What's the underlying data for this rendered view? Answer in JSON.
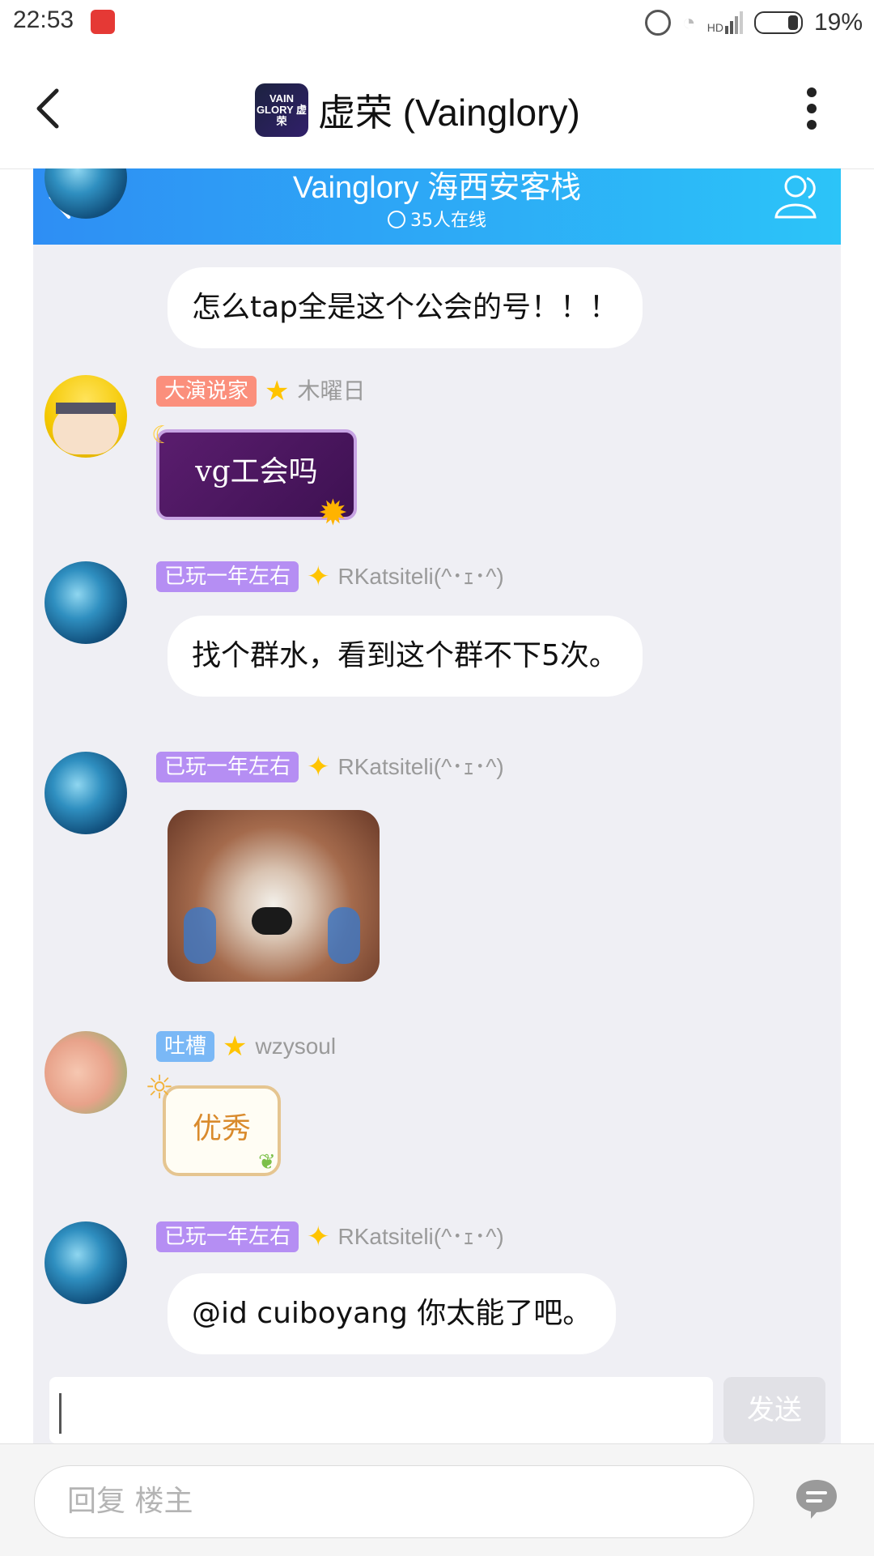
{
  "status_bar": {
    "time": "22:53",
    "battery": "19%",
    "network_label": "HD"
  },
  "app_bar": {
    "title": "虚荣 (Vainglory)",
    "logo_text": "VAIN GLORY 虚荣"
  },
  "chat": {
    "title": "Vainglory 海西安客栈",
    "online": "35人在线",
    "messages": [
      {
        "text": "怎么tap全是这个公会的号！！！"
      },
      {
        "badge": "大演说家",
        "nick": "木曜日",
        "text": "vg工会吗"
      },
      {
        "badge": "已玩一年左右",
        "nick": "RKatsiteli(^･ｪ･^)",
        "text": "找个群水，看到这个群不下5次。"
      },
      {
        "badge": "已玩一年左右",
        "nick": "RKatsiteli(^･ｪ･^)",
        "image": "red-panda-sticker"
      },
      {
        "badge": "吐槽",
        "nick": "wzysoul",
        "text": "优秀"
      },
      {
        "badge": "已玩一年左右",
        "nick": "RKatsiteli(^･ｪ･^)",
        "text": "@id cuiboyang 你太能了吧。"
      }
    ],
    "send_label": "发送"
  },
  "reply": {
    "placeholder": "回复  楼主"
  },
  "colors": {
    "header_start": "#2e8ef4",
    "header_end": "#2cc4f8",
    "chat_bg": "#efeff4"
  }
}
